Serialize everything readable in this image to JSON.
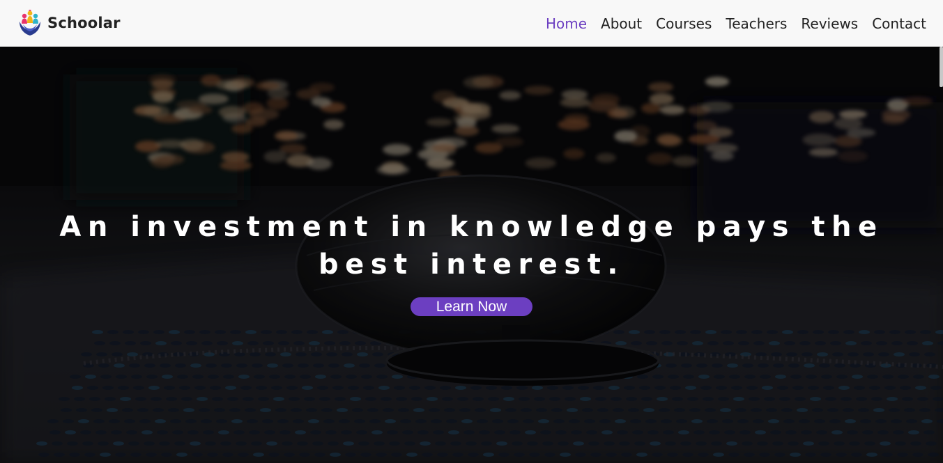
{
  "header": {
    "brand_name": "Schoolar",
    "logo_icon": "people-hands-logo-icon"
  },
  "nav": {
    "items": [
      {
        "label": "Home",
        "active": true
      },
      {
        "label": "About",
        "active": false
      },
      {
        "label": "Courses",
        "active": false
      },
      {
        "label": "Teachers",
        "active": false
      },
      {
        "label": "Reviews",
        "active": false
      },
      {
        "label": "Contact",
        "active": false
      }
    ]
  },
  "hero": {
    "headline": "An investment in knowledge pays the best interest.",
    "cta_label": "Learn Now",
    "background_description_icon": "globe-notebook-bokeh-photo"
  },
  "colors": {
    "accent": "#6c3fc1",
    "header_bg": "#f8f8f8",
    "text_dark": "#222222",
    "hero_text": "#ffffff"
  }
}
